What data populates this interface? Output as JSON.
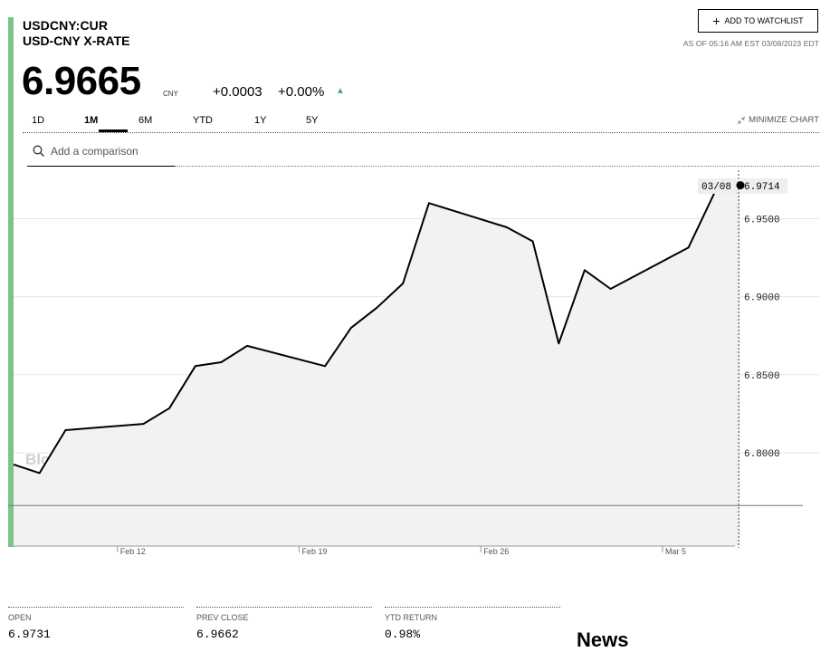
{
  "quote": {
    "ticker": "USDCNY:CUR",
    "name": "USD-CNY X-RATE",
    "watchlist_label": "ADD TO WATCHLIST",
    "as_of": "AS OF 05:16 AM EST 03/08/2023 EDT",
    "price": "6.9665",
    "currency": "CNY",
    "change": "+0.0003",
    "change_pct": "+0.00%",
    "up_arrow": "▲"
  },
  "tabs": [
    {
      "label": "1D"
    },
    {
      "label": "1M",
      "active": true
    },
    {
      "label": "6M"
    },
    {
      "label": "YTD"
    },
    {
      "label": "1Y"
    },
    {
      "label": "5Y"
    }
  ],
  "minimize_label": "MINIMIZE CHART",
  "search": {
    "placeholder": "Add a comparison"
  },
  "chart_data": {
    "type": "area",
    "watermark": "BloombergMarkets",
    "x": [
      "02/08",
      "02/09",
      "02/10",
      "02/13",
      "02/14",
      "02/15",
      "02/16",
      "02/17",
      "02/20",
      "02/21",
      "02/22",
      "02/23",
      "02/24",
      "02/27",
      "02/28",
      "03/01",
      "03/02",
      "03/03",
      "03/06",
      "03/07",
      "03/08"
    ],
    "series": [
      {
        "values": [
          6.7925,
          6.787,
          6.8145,
          6.8185,
          6.8285,
          6.8555,
          6.858,
          6.8685,
          6.8555,
          6.88,
          6.893,
          6.9085,
          6.96,
          6.9445,
          6.9355,
          6.87,
          6.917,
          6.905,
          6.9315,
          6.9665,
          6.9714
        ]
      }
    ],
    "x_tick_labels": [
      "Feb 12",
      "Feb 19",
      "Feb 26",
      "Mar 5"
    ],
    "y_ticks": [
      6.8,
      6.85,
      6.9,
      6.95
    ],
    "y_tick_labels": [
      "6.8000",
      "6.8500",
      "6.9000",
      "6.9500"
    ],
    "ylim": [
      6.7402,
      6.9822
    ],
    "reference_line": 6.7662,
    "crosshair": {
      "date": "03/08",
      "value": "6.9714"
    },
    "line_color": "#000000",
    "fill_color": "#f2f2f2",
    "grid": true
  },
  "stats": [
    {
      "label": "OPEN",
      "value": "6.9731"
    },
    {
      "label": "PREV CLOSE",
      "value": "6.9662"
    },
    {
      "label": "YTD RETURN",
      "value": "0.98%"
    }
  ],
  "news_heading": "News",
  "colors": {
    "accent": "#7cc48b",
    "up": "#4fb06a"
  }
}
